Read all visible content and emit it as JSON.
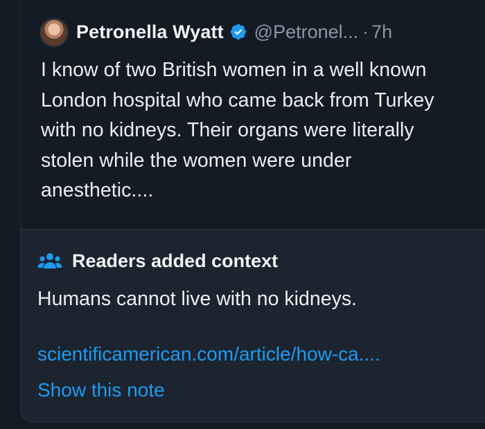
{
  "tweet": {
    "author_name": "Petronella Wyatt",
    "handle": "@Petronel...",
    "separator": "·",
    "time": "7h",
    "text": "I know of two British women in a well known London hospital who came back from Turkey with no kidneys. Their organs were literally stolen while the women were under anesthetic....",
    "avatar_icon": "avatar",
    "verified_icon": "verified-badge-icon"
  },
  "note": {
    "icon": "people-icon",
    "title": "Readers added context",
    "body": "Humans cannot live with no kidneys.",
    "link": "scientificamerican.com/article/how-ca....",
    "show_label": "Show this note"
  },
  "colors": {
    "background": "#141b24",
    "note_background": "#1c2430",
    "link": "#1d9bf0",
    "verified": "#1d9bf0",
    "muted_text": "#8b98a5",
    "text": "#eceff2"
  }
}
